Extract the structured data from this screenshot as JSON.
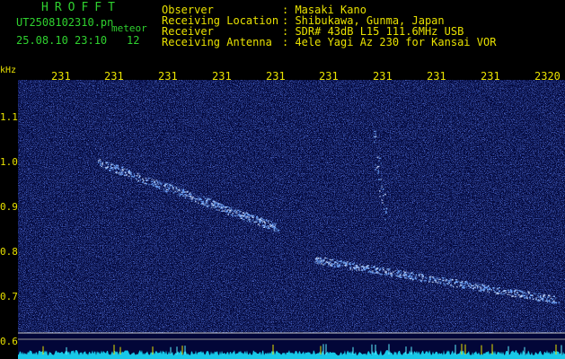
{
  "header": {
    "title": "HROFFT",
    "filename": "UT2508102310.pn",
    "mode": "meteor",
    "datetime": "25.08.10 23:10",
    "count": "12",
    "info": [
      {
        "label": "Observer",
        "value": ": Masaki Kano"
      },
      {
        "label": "Receiving Location",
        "value": ": Shibukawa, Gunma, Japan"
      },
      {
        "label": "Receiver",
        "value": ": SDR# 43dB L15 111.6MHz USB"
      },
      {
        "label": "Receiving Antenna",
        "value": ": 4ele Yagi Az 230 for Kansai VOR"
      }
    ]
  },
  "axes": {
    "y_unit": "kHz",
    "y_ticks": [
      "1.1",
      "1.0",
      "0.9",
      "0.8",
      "0.7",
      "0.6"
    ],
    "x_ticks": [
      "231",
      "231",
      "231",
      "231",
      "231",
      "231",
      "231",
      "231",
      "231",
      "2320"
    ]
  },
  "colors": {
    "label_text": "#2fd12f",
    "axis_text": "#e8e100",
    "background_noise": "#06107a",
    "echo": "#6fa8ff",
    "power_trace": "#18c8e8"
  }
}
